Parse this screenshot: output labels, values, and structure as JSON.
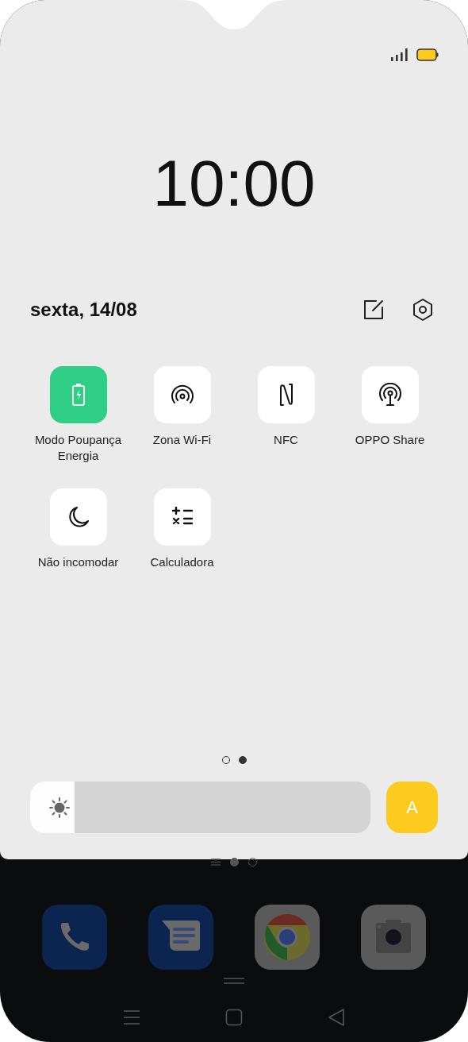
{
  "clock": "10:00",
  "date": "sexta, 14/08",
  "tiles": [
    {
      "kind": "battery",
      "label": "Modo Poupança Energia",
      "on": true
    },
    {
      "kind": "hotspot",
      "label": "Zona Wi-Fi",
      "on": false
    },
    {
      "kind": "nfc",
      "label": "NFC",
      "on": false
    },
    {
      "kind": "share",
      "label": "OPPO Share",
      "on": false
    },
    {
      "kind": "moon",
      "label": "Não incomodar",
      "on": false
    },
    {
      "kind": "calculator",
      "label": "Calculadora",
      "on": false
    }
  ],
  "pages": [
    {
      "selected": false
    },
    {
      "selected": true
    }
  ],
  "brightness": {
    "level": 0.13
  },
  "auto_brightness": {
    "label": "A",
    "on": true
  },
  "home_pages": [
    {
      "selected": true
    },
    {
      "selected": false
    }
  ]
}
